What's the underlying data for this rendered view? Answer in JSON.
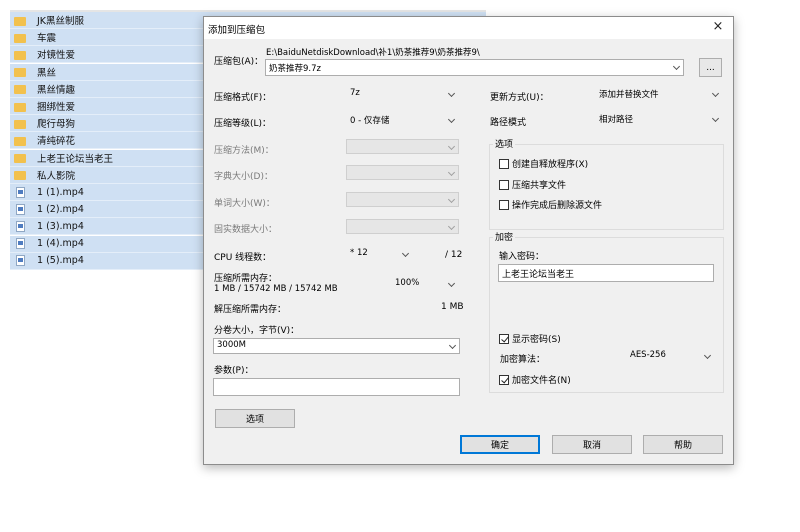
{
  "file_list": {
    "items": [
      {
        "name": "JK黑丝制服",
        "type": "folder-icon"
      },
      {
        "name": "车震",
        "type": "folder-icon"
      },
      {
        "name": "对镜性爱",
        "type": "folder-icon"
      },
      {
        "name": "黑丝",
        "type": "folder-icon"
      },
      {
        "name": "黑丝情趣",
        "type": "folder-icon"
      },
      {
        "name": "捆绑性爱",
        "type": "folder-icon"
      },
      {
        "name": "爬行母狗",
        "type": "folder-icon"
      },
      {
        "name": "清纯碎花",
        "type": "folder-icon"
      },
      {
        "name": "上老王论坛当老王",
        "type": "folder-icon"
      },
      {
        "name": "私人影院",
        "type": "folder-icon"
      },
      {
        "name": "1 (1).mp4",
        "type": "video-file-icon"
      },
      {
        "name": "1 (2).mp4",
        "type": "video-file-icon"
      },
      {
        "name": "1 (3).mp4",
        "type": "video-file-icon"
      },
      {
        "name": "1 (4).mp4",
        "type": "video-file-icon"
      },
      {
        "name": "1 (5).mp4",
        "type": "video-file-icon"
      }
    ]
  },
  "dialog": {
    "title": "添加到压缩包",
    "close_icon": "×",
    "archive_label": "压缩包(A)：",
    "archive_path": "E:\\BaiduNetdiskDownload\\补1\\奶茶推荐9\\奶茶推荐9\\",
    "archive_name": "奶茶推荐9.7z",
    "browse_label": "...",
    "format_label": "压缩格式(F)：",
    "format_value": "7z",
    "level_label": "压缩等级(L)：",
    "level_value": "0 - 仅存储",
    "method_label": "压缩方法(M)：",
    "dict_label": "字典大小(D)：",
    "word_label": "单词大小(W)：",
    "solid_label": "固实数据大小：",
    "cpu_label": "CPU 线程数：",
    "cpu_value": "* 12",
    "cpu_max": "/ 12",
    "mem_comp_label": "压缩所需内存：",
    "mem_comp_detail": "1 MB / 15742 MB / 15742 MB",
    "mem_percent": "100%",
    "mem_decomp_label": "解压缩所需内存：",
    "mem_decomp_value": "1 MB",
    "volume_label": "分卷大小，字节(V)：",
    "volume_value": "3000M",
    "params_label": "参数(P)：",
    "params_value": "",
    "options_button": "选项",
    "update_label": "更新方式(U)：",
    "update_value": "添加并替换文件",
    "path_label": "路径模式",
    "path_value": "相对路径",
    "options_group": "选项",
    "opt_sfx": "创建自释放程序(X)",
    "opt_shared": "压缩共享文件",
    "opt_delete": "操作完成后删除源文件",
    "encrypt_group": "加密",
    "password_label": "输入密码：",
    "password_value": "上老王论坛当老王",
    "show_password": "显示密码(S)",
    "enc_method_label": "加密算法：",
    "enc_method_value": "AES-256",
    "encrypt_names": "加密文件名(N)",
    "ok_button": "确定",
    "cancel_button": "取消",
    "help_button": "帮助"
  }
}
